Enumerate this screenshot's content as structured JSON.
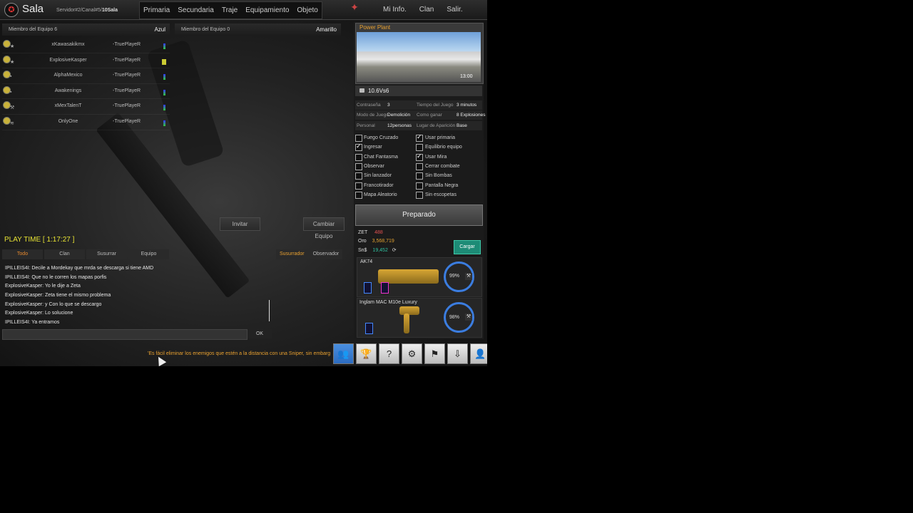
{
  "header": {
    "room_title": "Sala",
    "server_prefix": "Servidor#2/Canal#5/",
    "room_number": "10Sala",
    "nav": [
      "Primaria",
      "Secundaria",
      "Traje",
      "Equipamiento",
      "Objeto"
    ],
    "right_nav": [
      "Mi Info.",
      "Clan",
      "Salir."
    ]
  },
  "team_blue": {
    "label": "Miembro del Equipo 6",
    "side": "Azul",
    "players": [
      {
        "name": "xKawasakikmx",
        "clan": "-TruePlayeR"
      },
      {
        "name": "ExplosiveKasper",
        "clan": "-TruePlayeR"
      },
      {
        "name": "AlphaMexico",
        "clan": "-TruePlayeR"
      },
      {
        "name": "Awakenings",
        "clan": "-TruePlayeR"
      },
      {
        "name": "xMexTalenT",
        "clan": "-TruePlayeR"
      },
      {
        "name": "OnlyOne",
        "clan": "-TruePlayeR"
      }
    ]
  },
  "team_yellow": {
    "label": "Miembro del Equipo 0",
    "side": "Amarillo"
  },
  "buttons": {
    "invite": "Invitar",
    "change_team": "Cambiar Equipo",
    "ready": "Preparado",
    "ok": "OK",
    "load": "Cargar"
  },
  "play_time": "PLAY TIME [ 1:17:27 ]",
  "chat_tabs": [
    "Todo",
    "Clan",
    "Susurrar",
    "Equipo"
  ],
  "chat_side_tabs": [
    "Susurrador",
    "Observador"
  ],
  "chat": [
    "IPILLEIS4I: Decile a Mordekay que mrda se descarga si tiene AMD",
    "IPILLEIS4I: Que no le corren los mapas porfis",
    "ExplosiveKasper: Yo le dije a Zeta",
    "ExplosiveKasper: Zeta tiene el mismo problema",
    "ExplosiveKasper: y Con lo que se descargo",
    "ExplosiveKasper: Lo solucione",
    "IPILLEIS4I: Ya entramos"
  ],
  "tip": "'Es fácil eliminar los enemigos que estén a la distancia con una Sniper, sin embarg",
  "map": {
    "name": "Power Plant",
    "time": "13:00"
  },
  "room_name": "10.6Vs6",
  "room_info": [
    {
      "k1": "Contraseña",
      "v1": "3",
      "k2": "Tiempo del Juego",
      "v2": "3 minutos"
    },
    {
      "k1": "Modo de Juego",
      "v1": "Demolición",
      "k2": "Como ganar",
      "v2": "8 Explosiones"
    },
    {
      "k1": "Personal",
      "v1": "12personas",
      "k2": "Lugar de Aparición",
      "v2": "Base"
    }
  ],
  "options_left": [
    {
      "label": "Fuego Cruzado",
      "checked": false
    },
    {
      "label": "Ingresar",
      "checked": true
    },
    {
      "label": "Chat Fantasma",
      "checked": false
    },
    {
      "label": "Observar",
      "checked": false
    },
    {
      "label": "Sin lanzador",
      "checked": false
    },
    {
      "label": "Francotirador",
      "checked": false
    },
    {
      "label": "Mapa Aleatorio",
      "checked": false
    }
  ],
  "options_right": [
    {
      "label": "Usar primaria",
      "checked": true
    },
    {
      "label": "Equilibrio equipo",
      "checked": false
    },
    {
      "label": "Usar Mira",
      "checked": true
    },
    {
      "label": "Cerrar combate",
      "checked": false
    },
    {
      "label": "Sin Bombas",
      "checked": false
    },
    {
      "label": "Pantalla Negra",
      "checked": false
    },
    {
      "label": "Sin escopetas",
      "checked": false
    }
  ],
  "currency": [
    {
      "label": "ZET",
      "value": "488",
      "color": "#e05050"
    },
    {
      "label": "Oro",
      "value": "3,568,719",
      "color": "#e0a030"
    },
    {
      "label": "Sn$",
      "value": "19,452",
      "color": "#30c0a0"
    }
  ],
  "weapons": [
    {
      "name": "AK74",
      "durability": "99%",
      "durability_value": 0.99
    },
    {
      "name": "Inglam MAC M10e Luxury",
      "durability": "98%",
      "durability_value": 0.98
    }
  ],
  "bottom_icons": [
    "users-icon",
    "trophy-icon",
    "help-icon",
    "gear-icon",
    "flag-icon",
    "download-icon",
    "profile-icon"
  ],
  "colors": {
    "accent": "#e8a030",
    "play_time": "#e6e233",
    "ready_button": "#4a4a4a",
    "load_button": "#1d8b76"
  }
}
